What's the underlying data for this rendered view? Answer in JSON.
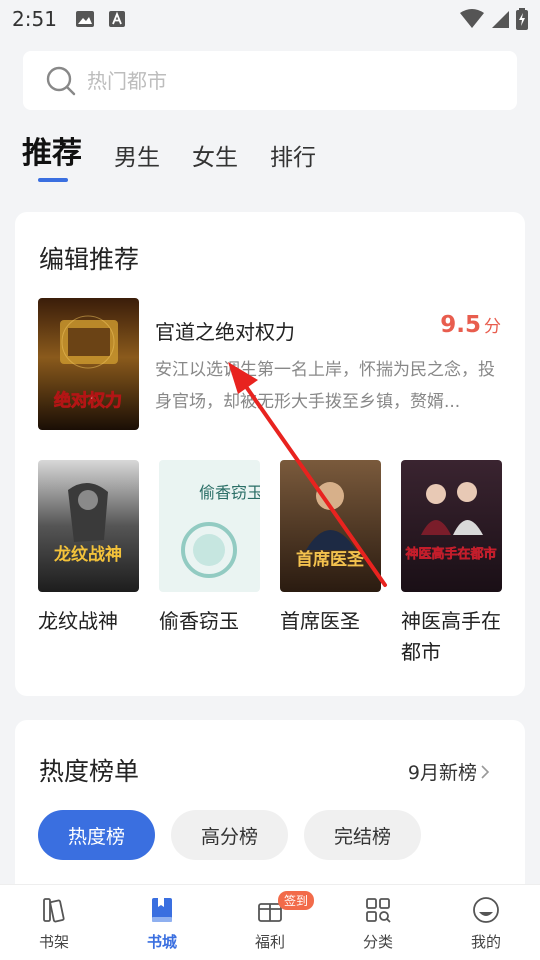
{
  "status_bar": {
    "time": "2:51"
  },
  "search": {
    "placeholder": "热门都市"
  },
  "tabs": [
    {
      "label": "推荐",
      "active": true
    },
    {
      "label": "男生"
    },
    {
      "label": "女生"
    },
    {
      "label": "排行"
    }
  ],
  "editor_section": {
    "title": "编辑推荐",
    "featured": {
      "title": "官道之绝对权力",
      "score": "9.5",
      "score_unit": "分",
      "description": "安江以选调生第一名上岸，怀揣为民之念，投身官场，却被无形大手拨至乡镇，赘婿...",
      "cover_text": "绝对权力"
    },
    "books": [
      {
        "title": "龙纹战神",
        "cover_text": "龙纹战神"
      },
      {
        "title": "偷香窃玉",
        "cover_text": "偷香窃玉"
      },
      {
        "title": "首席医圣",
        "cover_text": "首席医圣"
      },
      {
        "title": "神医高手在都市",
        "cover_text": "神医高手在都市"
      }
    ]
  },
  "hot_section": {
    "title": "热度榜单",
    "more_label": "9月新榜",
    "chips": [
      {
        "label": "热度榜",
        "active": true
      },
      {
        "label": "高分榜"
      },
      {
        "label": "完结榜"
      }
    ]
  },
  "bottom_nav": [
    {
      "label": "书架",
      "icon": "bookshelf-icon"
    },
    {
      "label": "书城",
      "icon": "book-icon",
      "active": true
    },
    {
      "label": "福利",
      "icon": "gift-icon",
      "badge": "签到"
    },
    {
      "label": "分类",
      "icon": "category-icon"
    },
    {
      "label": "我的",
      "icon": "profile-icon"
    }
  ],
  "colors": {
    "accent": "#3a6fe0",
    "score": "#e85d4e",
    "badge": "#f26b4a",
    "annotation_arrow": "#e8231f"
  }
}
